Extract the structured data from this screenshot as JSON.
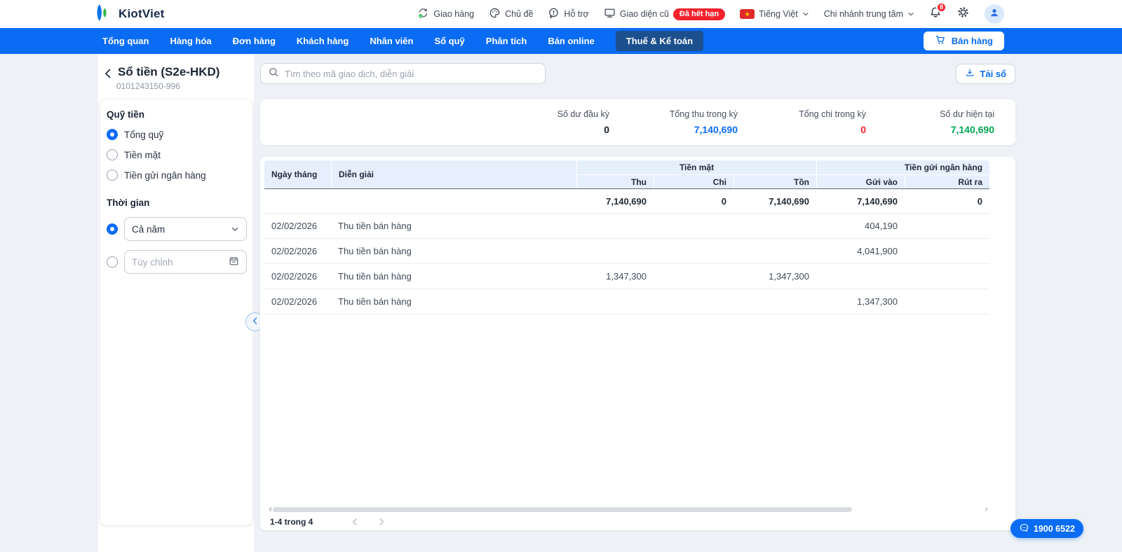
{
  "header": {
    "brand": "KiotViet",
    "menu": [
      {
        "label": "Giao hàng",
        "icon": "delivery-icon"
      },
      {
        "label": "Chủ đề",
        "icon": "palette-icon"
      },
      {
        "label": "Hỗ trợ",
        "icon": "help-icon"
      },
      {
        "label": "Giao diện cũ",
        "icon": "monitor-icon",
        "badge": "Đã hết hạn"
      }
    ],
    "language": "Tiếng Việt",
    "branch": "Chi nhánh trung tâm",
    "notification_count": "8"
  },
  "nav": {
    "tabs": [
      {
        "label": "Tổng quan",
        "active": false
      },
      {
        "label": "Hàng hóa",
        "active": false
      },
      {
        "label": "Đơn hàng",
        "active": false
      },
      {
        "label": "Khách hàng",
        "active": false
      },
      {
        "label": "Nhân viên",
        "active": false
      },
      {
        "label": "Sổ quỹ",
        "active": false
      },
      {
        "label": "Phân tích",
        "active": false
      },
      {
        "label": "Bán online",
        "active": false
      },
      {
        "label": "Thuế & Kế toán",
        "active": true
      }
    ],
    "sell_button": "Bán hàng"
  },
  "sidebar": {
    "title": "Sổ tiền (S2e-HKD)",
    "tax_code": "0101243150-996",
    "fund": {
      "title": "Quỹ tiền",
      "options": [
        {
          "label": "Tổng quỹ",
          "selected": true
        },
        {
          "label": "Tiền mặt",
          "selected": false
        },
        {
          "label": "Tiền gửi ngân hàng",
          "selected": false
        }
      ]
    },
    "time": {
      "title": "Thời gian",
      "preset_value": "Cả năm",
      "preset_selected": true,
      "custom_placeholder": "Tùy chỉnh"
    }
  },
  "toolbar": {
    "search_placeholder": "Tìm theo mã giao dịch, diễn giải",
    "download_label": "Tải sổ"
  },
  "summary": {
    "opening": {
      "label": "Số dư đầu kỳ",
      "value": "0"
    },
    "income": {
      "label": "Tổng thu trong kỳ",
      "value": "7,140,690"
    },
    "expense": {
      "label": "Tổng chi trong kỳ",
      "value": "0"
    },
    "current": {
      "label": "Số dư hiện tại",
      "value": "7,140,690"
    }
  },
  "table": {
    "header": {
      "date": "Ngày tháng",
      "desc": "Diễn giải",
      "cash_group": "Tiền mặt",
      "bank_group": "Tiền gửi ngân hàng",
      "thu": "Thu",
      "chi": "Chi",
      "ton": "Tồn",
      "deposit": "Gửi vào",
      "withdraw": "Rút ra"
    },
    "totals": {
      "thu": "7,140,690",
      "chi": "0",
      "ton": "7,140,690",
      "deposit": "7,140,690",
      "withdraw": "0"
    },
    "rows": [
      {
        "date": "02/02/2026",
        "desc": "Thu tiền bán hàng",
        "thu": "",
        "chi": "",
        "ton": "",
        "deposit": "404,190",
        "withdraw": ""
      },
      {
        "date": "02/02/2026",
        "desc": "Thu tiền bán hàng",
        "thu": "",
        "chi": "",
        "ton": "",
        "deposit": "4,041,900",
        "withdraw": ""
      },
      {
        "date": "02/02/2026",
        "desc": "Thu tiền bán hàng",
        "thu": "1,347,300",
        "chi": "",
        "ton": "1,347,300",
        "deposit": "",
        "withdraw": ""
      },
      {
        "date": "02/02/2026",
        "desc": "Thu tiền bán hàng",
        "thu": "",
        "chi": "",
        "ton": "",
        "deposit": "1,347,300",
        "withdraw": ""
      }
    ],
    "pagination": "1-4 trong 4"
  },
  "support": {
    "hotline": "1900 6522"
  },
  "colors": {
    "primary": "#0a6cf5",
    "active_tab": "#1c4f8e",
    "income": "#0a6cf5",
    "expense": "#f5222d",
    "balance": "#00a651",
    "expired_badge": "#f5222d",
    "table_header_bg": "#e6effc"
  }
}
